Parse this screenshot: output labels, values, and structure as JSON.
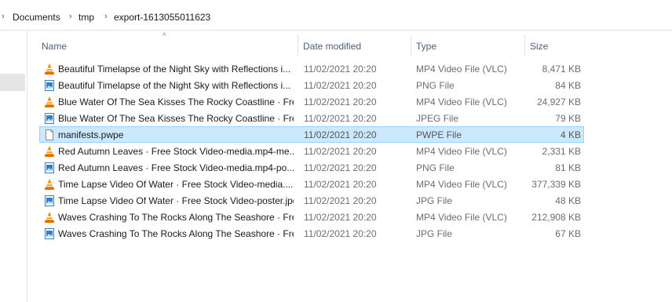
{
  "breadcrumb": {
    "items": [
      "Documents",
      "tmp",
      "export-1613055011623"
    ]
  },
  "columns": {
    "name": "Name",
    "date_modified": "Date modified",
    "type": "Type",
    "size": "Size"
  },
  "files": [
    {
      "name": "Beautiful Timelapse of the Night Sky with Reflections i...",
      "date": "11/02/2021 20:20",
      "type": "MP4 Video File (VLC)",
      "size": "8,471 KB",
      "icon": "vlc-cone-icon"
    },
    {
      "name": "Beautiful Timelapse of the Night Sky with Reflections i...",
      "date": "11/02/2021 20:20",
      "type": "PNG File",
      "size": "84 KB",
      "icon": "image-file-icon"
    },
    {
      "name": "Blue Water Of The Sea Kisses The Rocky Coastline · Fre...",
      "date": "11/02/2021 20:20",
      "type": "MP4 Video File (VLC)",
      "size": "24,927 KB",
      "icon": "vlc-cone-icon"
    },
    {
      "name": "Blue Water Of The Sea Kisses The Rocky Coastline · Fre...",
      "date": "11/02/2021 20:20",
      "type": "JPEG File",
      "size": "79 KB",
      "icon": "image-file-icon"
    },
    {
      "name": "manifests.pwpe",
      "date": "11/02/2021 20:20",
      "type": "PWPE File",
      "size": "4 KB",
      "icon": "blank-file-icon",
      "selected": true
    },
    {
      "name": "Red Autumn Leaves · Free Stock Video-media.mp4-me...",
      "date": "11/02/2021 20:20",
      "type": "MP4 Video File (VLC)",
      "size": "2,331 KB",
      "icon": "vlc-cone-icon"
    },
    {
      "name": "Red Autumn Leaves · Free Stock Video-media.mp4-po...",
      "date": "11/02/2021 20:20",
      "type": "PNG File",
      "size": "81 KB",
      "icon": "image-file-icon"
    },
    {
      "name": "Time Lapse Video Of Water · Free Stock Video-media....",
      "date": "11/02/2021 20:20",
      "type": "MP4 Video File (VLC)",
      "size": "377,339 KB",
      "icon": "vlc-cone-icon"
    },
    {
      "name": "Time Lapse Video Of Water · Free Stock Video-poster.jpg",
      "date": "11/02/2021 20:20",
      "type": "JPG File",
      "size": "48 KB",
      "icon": "image-file-icon"
    },
    {
      "name": "Waves Crashing To The Rocks Along The Seashore · Fre...",
      "date": "11/02/2021 20:20",
      "type": "MP4 Video File (VLC)",
      "size": "212,908 KB",
      "icon": "vlc-cone-icon"
    },
    {
      "name": "Waves Crashing To The Rocks Along The Seashore · Fre...",
      "date": "11/02/2021 20:20",
      "type": "JPG File",
      "size": "67 KB",
      "icon": "image-file-icon"
    }
  ],
  "colors": {
    "selection_bg": "#cce8ff",
    "selection_border": "#99d1ff",
    "vlc_orange": "#f08a00"
  }
}
